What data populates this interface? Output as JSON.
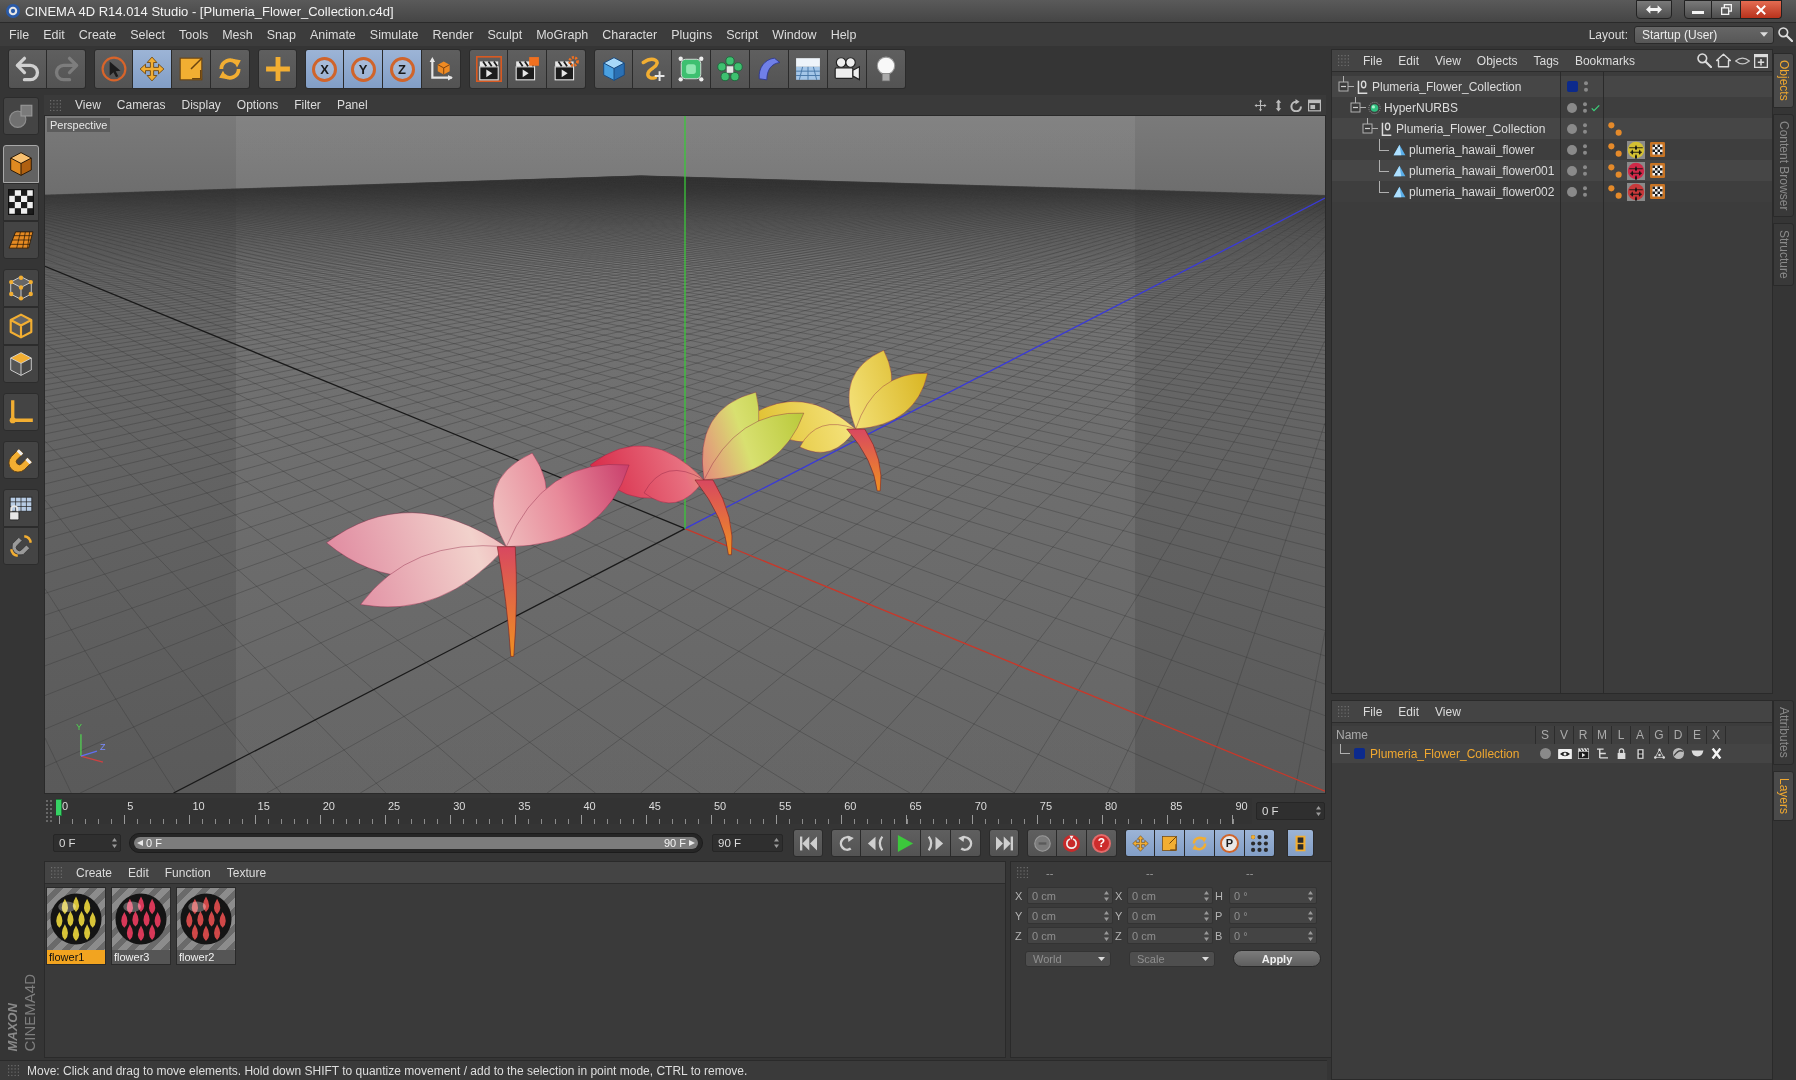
{
  "window": {
    "title": "CINEMA 4D R14.014 Studio - [Plumeria_Flower_Collection.c4d]"
  },
  "menu_bar": [
    "File",
    "Edit",
    "Create",
    "Select",
    "Tools",
    "Mesh",
    "Snap",
    "Animate",
    "Simulate",
    "Render",
    "Sculpt",
    "MoGraph",
    "Character",
    "Plugins",
    "Script",
    "Window",
    "Help"
  ],
  "layout": {
    "label": "Layout:",
    "value": "Startup (User)"
  },
  "toolbar": [
    [
      {
        "kind": "undo",
        "selected": false,
        "disabled": false
      },
      {
        "kind": "redo",
        "selected": false,
        "disabled": true
      }
    ],
    [
      {
        "kind": "pointer",
        "selected": false
      },
      {
        "kind": "move",
        "selected": true
      },
      {
        "kind": "scale",
        "selected": false
      },
      {
        "kind": "rotate",
        "selected": false
      }
    ],
    [
      {
        "kind": "plus",
        "selected": false
      }
    ],
    [
      {
        "kind": "lock",
        "label": "X",
        "selected": true
      },
      {
        "kind": "lock",
        "label": "Y",
        "selected": true
      },
      {
        "kind": "lock",
        "label": "Z",
        "selected": true
      },
      {
        "kind": "coords",
        "selected": false
      }
    ],
    [
      {
        "kind": "render",
        "selected": false
      },
      {
        "kind": "renderview",
        "selected": false
      },
      {
        "kind": "rendersettings",
        "selected": false
      }
    ],
    [
      {
        "kind": "cube",
        "selected": false
      },
      {
        "kind": "spline",
        "selected": false
      },
      {
        "kind": "nurbs",
        "selected": false
      },
      {
        "kind": "cloner",
        "selected": false
      },
      {
        "kind": "deformer",
        "selected": false
      },
      {
        "kind": "floor",
        "selected": false
      },
      {
        "kind": "camera",
        "selected": false
      },
      {
        "kind": "light",
        "selected": false
      }
    ]
  ],
  "mode_toolbar": [
    [
      {
        "kind": "editable",
        "selected": false
      }
    ],
    [
      {
        "kind": "model",
        "selected": true
      },
      {
        "kind": "texture",
        "selected": false
      },
      {
        "kind": "workplane",
        "selected": false
      }
    ],
    [
      {
        "kind": "points",
        "selected": false
      },
      {
        "kind": "edges",
        "selected": false
      },
      {
        "kind": "polygons",
        "selected": false
      }
    ],
    [
      {
        "kind": "axis",
        "selected": false
      }
    ],
    [
      {
        "kind": "magnet",
        "selected": false
      }
    ],
    [
      {
        "kind": "snap",
        "selected": false
      },
      {
        "kind": "snapsettings",
        "selected": false
      }
    ]
  ],
  "viewport": {
    "menu": [
      "View",
      "Cameras",
      "Display",
      "Options",
      "Filter",
      "Panel"
    ],
    "nav": [
      {
        "kind": "pan"
      },
      {
        "kind": "zoom"
      },
      {
        "kind": "orbit"
      },
      {
        "kind": "maximize"
      }
    ],
    "camera": "Perspective",
    "gizmo_labels": [
      "Y",
      "Z"
    ]
  },
  "object_manager": {
    "menu": [
      "File",
      "Edit",
      "View",
      "Objects",
      "Tags",
      "Bookmarks"
    ],
    "tools": [
      {
        "kind": "search"
      },
      {
        "kind": "home"
      },
      {
        "kind": "eye"
      },
      {
        "kind": "newwindow"
      }
    ],
    "tree": [
      {
        "name": "Plumeria_Flower_Collection",
        "kind": "null",
        "expanded": true,
        "selected": false,
        "color": "#0c2a8c",
        "children": [
          {
            "name": "HyperNURBS",
            "kind": "hypernurbs",
            "expanded": true,
            "selected": false,
            "enabled": true,
            "children": [
              {
                "name": "Plumeria_Flower_Collection",
                "kind": "null",
                "expanded": true,
                "selected": false,
                "tags": [
                  {
                    "kind": "phong"
                  }
                ],
                "children": [
                  {
                    "name": "plumeria_hawaii_flower",
                    "kind": "polygon",
                    "selected": false,
                    "tags": [
                      {
                        "kind": "phong"
                      },
                      {
                        "kind": "material",
                        "color": "#d4c032"
                      },
                      {
                        "kind": "uvw"
                      }
                    ]
                  },
                  {
                    "name": "plumeria_hawaii_flower001",
                    "kind": "polygon",
                    "selected": false,
                    "tags": [
                      {
                        "kind": "phong"
                      },
                      {
                        "kind": "material",
                        "color": "#d02848"
                      },
                      {
                        "kind": "uvw"
                      }
                    ]
                  },
                  {
                    "name": "plumeria_hawaii_flower002",
                    "kind": "polygon",
                    "selected": false,
                    "tags": [
                      {
                        "kind": "phong"
                      },
                      {
                        "kind": "material",
                        "color": "#c8383a"
                      },
                      {
                        "kind": "uvw"
                      }
                    ]
                  }
                ]
              }
            ]
          }
        ]
      }
    ]
  },
  "side_tabs": {
    "upper": [
      {
        "label": "Objects",
        "selected": true
      },
      {
        "label": "Content Browser",
        "selected": false
      },
      {
        "label": "Structure",
        "selected": false
      }
    ],
    "lower": [
      {
        "label": "Attributes",
        "selected": false
      },
      {
        "label": "Layers",
        "selected": true
      }
    ]
  },
  "layer_manager": {
    "menu": [
      "File",
      "Edit",
      "View"
    ],
    "columns": [
      "Name",
      "S",
      "V",
      "R",
      "M",
      "L",
      "A",
      "G",
      "D",
      "E",
      "X"
    ],
    "rows": [
      {
        "name": "Plumeria_Flower_Collection",
        "color": "#0c2a8c",
        "selected": true,
        "flags": [
          {
            "kind": "solo"
          },
          {
            "kind": "visible"
          },
          {
            "kind": "render"
          },
          {
            "kind": "manager"
          },
          {
            "kind": "locked"
          },
          {
            "kind": "animation"
          },
          {
            "kind": "generators"
          },
          {
            "kind": "deformers"
          },
          {
            "kind": "expressions"
          },
          {
            "kind": "xref"
          }
        ]
      }
    ]
  },
  "timeline": {
    "ticks": [
      "0",
      "5",
      "10",
      "15",
      "20",
      "25",
      "30",
      "35",
      "40",
      "45",
      "50",
      "55",
      "60",
      "65",
      "70",
      "75",
      "80",
      "85",
      "90"
    ],
    "playhead": {
      "level": 0
    },
    "current": "0 F",
    "start": "0 F",
    "range": {
      "level": 1,
      "start": "0 F",
      "end": "90 F"
    },
    "end": "90 F"
  },
  "playback": [
    [
      {
        "kind": "first"
      }
    ],
    [
      {
        "kind": "prevkey"
      },
      {
        "kind": "prevframe"
      },
      {
        "kind": "play"
      },
      {
        "kind": "nextframe"
      },
      {
        "kind": "nextkey"
      }
    ],
    [
      {
        "kind": "last"
      }
    ]
  ],
  "record": [
    {
      "kind": "record",
      "selected": false
    },
    {
      "kind": "autokey",
      "selected": false
    },
    {
      "kind": "keyselection",
      "label": "?",
      "selected": false
    }
  ],
  "key_modes": [
    {
      "kind": "position",
      "selected": true
    },
    {
      "kind": "scale",
      "selected": true
    },
    {
      "kind": "rotation",
      "selected": true
    },
    {
      "kind": "parameter",
      "label": "P",
      "selected": true
    },
    {
      "kind": "pla",
      "selected": true
    }
  ],
  "timeline_button": {
    "kind": "timeline",
    "selected": true
  },
  "material_manager": {
    "menu": [
      "Create",
      "Edit",
      "Function",
      "Texture"
    ],
    "materials": [
      {
        "name": "flower1",
        "selected": true,
        "color": "#d8c438"
      },
      {
        "name": "flower3",
        "selected": false,
        "color": "#d83858"
      },
      {
        "name": "flower2",
        "selected": false,
        "color": "#d04848"
      }
    ]
  },
  "coordinates": {
    "disabled": true,
    "headers": [
      "--",
      "--",
      "--"
    ],
    "columns": [
      [
        {
          "label": "X",
          "value": "0 cm"
        },
        {
          "label": "Y",
          "value": "0 cm"
        },
        {
          "label": "Z",
          "value": "0 cm"
        }
      ],
      [
        {
          "label": "X",
          "value": "0 cm"
        },
        {
          "label": "Y",
          "value": "0 cm"
        },
        {
          "label": "Z",
          "value": "0 cm"
        }
      ],
      [
        {
          "label": "H",
          "value": "0 °"
        },
        {
          "label": "P",
          "value": "0 °"
        },
        {
          "label": "B",
          "value": "0 °"
        }
      ]
    ],
    "dropdowns": [
      "World",
      "Scale"
    ],
    "apply": "Apply"
  },
  "status_bar": {
    "text": "Move: Click and drag to move elements. Hold down SHIFT to quantize movement / add to the selection in point mode, CTRL to remove."
  },
  "logo": {
    "brand": "MAXON",
    "product": "CINEMA4D"
  }
}
